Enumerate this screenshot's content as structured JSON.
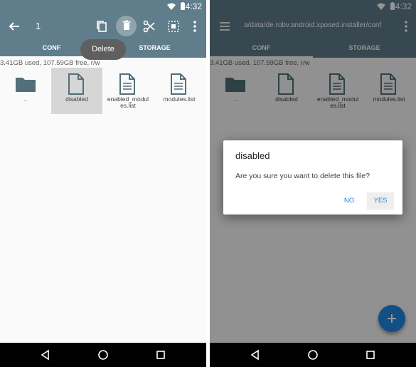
{
  "status_bar": {
    "time": "4:32"
  },
  "left_screen": {
    "selection_count": "1",
    "tooltip": "Delete",
    "tabs": [
      {
        "label": "CONF"
      },
      {
        "label": "STORAGE"
      }
    ],
    "storage_info": "3.41GB used, 107.59GB free, r/w",
    "files": [
      {
        "name": "..",
        "kind": "folder"
      },
      {
        "name": "disabled",
        "kind": "file",
        "selected": true
      },
      {
        "name": "enabled_modules.list",
        "kind": "file"
      },
      {
        "name": "modules.list",
        "kind": "file"
      }
    ],
    "colors": {
      "toolbar": "#607d8b",
      "selection": "#d6d6d6",
      "active_tab_indicator": "#ffffff"
    }
  },
  "right_screen": {
    "path": "a/data/de.robv.android.xposed.installer/conf",
    "tabs": [
      {
        "label": "CONF"
      },
      {
        "label": "STORAGE"
      }
    ],
    "storage_info": "3.41GB used, 107.59GB free, r/w",
    "files": [
      {
        "name": "..",
        "kind": "folder"
      },
      {
        "name": "disabled",
        "kind": "file"
      },
      {
        "name": "enabled_modules.list",
        "kind": "file"
      },
      {
        "name": "modules.list",
        "kind": "file"
      }
    ],
    "dialog": {
      "title": "disabled",
      "message": "Are you sure you want to delete this file?",
      "no_label": "NO",
      "yes_label": "YES"
    },
    "fab_icon": "add-icon",
    "colors": {
      "accent": "#1e88e5"
    }
  }
}
